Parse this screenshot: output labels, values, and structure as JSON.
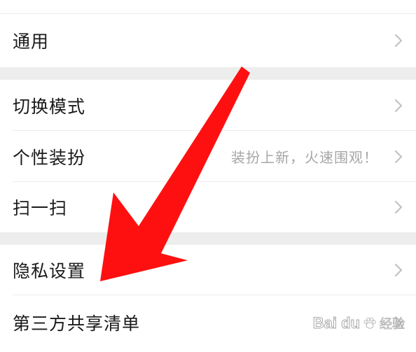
{
  "settings": {
    "groups": [
      {
        "items": [
          {
            "label": "通用",
            "hint": ""
          }
        ]
      },
      {
        "items": [
          {
            "label": "切换模式",
            "hint": ""
          },
          {
            "label": "个性装扮",
            "hint": "装扮上新，火速围观！"
          },
          {
            "label": "扫一扫",
            "hint": ""
          }
        ]
      },
      {
        "items": [
          {
            "label": "隐私设置",
            "hint": ""
          },
          {
            "label": "第三方共享清单",
            "hint": ""
          }
        ]
      }
    ]
  },
  "annotation": {
    "arrow_color": "#ff1010",
    "points_to": "隐私设置"
  },
  "watermark": {
    "logo": "Bai  du",
    "sub": "经验"
  },
  "colors": {
    "label": "#1a1a1a",
    "hint": "#a6a6a6",
    "chevron": "#c2c2c2",
    "group_gap": "#ededed",
    "divider": "#ededed"
  }
}
